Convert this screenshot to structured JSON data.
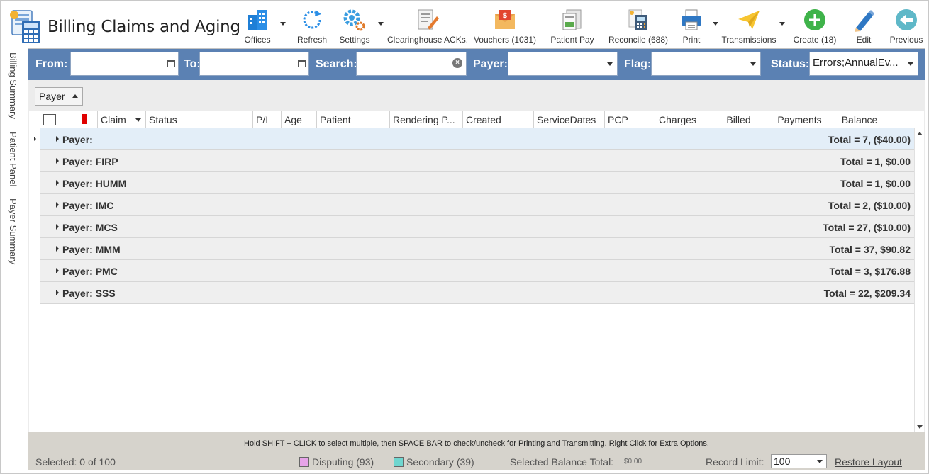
{
  "app": {
    "title": "Billing Claims and Aging"
  },
  "toolbar": {
    "offices": "Offices",
    "refresh": "Refresh",
    "settings": "Settings",
    "clearinghouse": "Clearinghouse ACKs.",
    "vouchers": "Vouchers (1031)",
    "patient_pay": "Patient Pay",
    "reconcile": "Reconcile (688)",
    "print": "Print",
    "transmissions": "Transmissions",
    "create": "Create (18)",
    "edit": "Edit",
    "previous": "Previous"
  },
  "side_tabs": [
    "Billing Summary",
    "Patient Panel",
    "Payer Summary"
  ],
  "filters": {
    "from_label": "From:",
    "to_label": "To:",
    "search_label": "Search:",
    "payer_label": "Payer:",
    "flag_label": "Flag:",
    "status_label": "Status:",
    "from_value": "",
    "to_value": "",
    "search_value": "",
    "payer_value": "",
    "flag_value": "",
    "status_value": "Errors;AnnualEv..."
  },
  "group_by": "Payer",
  "columns": [
    "Claim",
    "Status",
    "P/I",
    "Age",
    "Patient",
    "Rendering P...",
    "Created",
    "ServiceDates",
    "PCP",
    "Charges",
    "Billed",
    "Payments",
    "Balance"
  ],
  "groups": [
    {
      "label": "Payer:",
      "total": "Total = 7,  ($40.00)"
    },
    {
      "label": "Payer: FIRP",
      "total": "Total = 1,  $0.00"
    },
    {
      "label": "Payer: HUMM",
      "total": "Total = 1,  $0.00"
    },
    {
      "label": "Payer: IMC",
      "total": "Total = 2,  ($10.00)"
    },
    {
      "label": "Payer: MCS",
      "total": "Total = 27,  ($10.00)"
    },
    {
      "label": "Payer: MMM",
      "total": "Total = 37,  $90.82"
    },
    {
      "label": "Payer: PMC",
      "total": "Total = 3,  $176.88"
    },
    {
      "label": "Payer: SSS",
      "total": "Total = 22,  $209.34"
    }
  ],
  "footer": {
    "hint": "Hold SHIFT + CLICK to select multiple, then SPACE BAR to check/uncheck for Printing and Transmitting. Right Click for Extra Options.",
    "selected": "Selected: 0 of 100",
    "disputing": "Disputing (93)",
    "secondary": "Secondary (39)",
    "selected_balance_label": "Selected Balance Total:",
    "selected_balance_value": "$0.00",
    "record_limit_label": "Record Limit:",
    "record_limit_value": "100",
    "restore_layout": "Restore Layout"
  },
  "colors": {
    "filter_bar": "#5b81b3",
    "disputing": "#e6a3e8",
    "secondary": "#6fd6cf",
    "flag": "#e00000"
  }
}
